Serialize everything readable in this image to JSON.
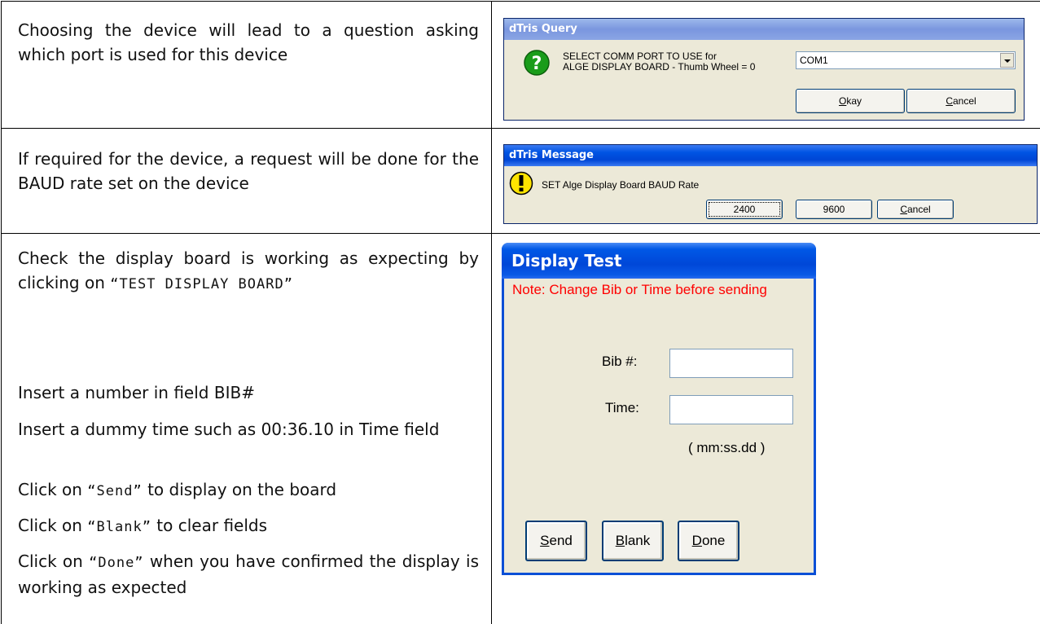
{
  "rows": [
    {
      "text": "Choosing the device will lead to a question asking which port is used for this device",
      "dialog": {
        "title": "dTris Query",
        "prompt_line1": "SELECT COMM PORT TO USE for",
        "prompt_line2": "ALGE DISPLAY BOARD - Thumb Wheel = 0",
        "combo_value": "COM1",
        "ok_label_mnemonic": "O",
        "ok_label_rest": "kay",
        "cancel_label_mnemonic": "C",
        "cancel_label_rest": "ancel",
        "icon": "question-icon"
      }
    },
    {
      "text": "If required for the device, a request will be done for the BAUD rate set on the device",
      "dialog": {
        "title": "dTris Message",
        "prompt": "SET Alge Display Board BAUD Rate",
        "btn1": "2400",
        "btn2": "9600",
        "cancel_label_mnemonic": "C",
        "cancel_label_rest": "ancel",
        "icon": "exclamation-icon"
      }
    },
    {
      "text_intro_1": "Check the display board is working as expecting by clicking on ",
      "text_intro_code": "“TEST DISPLAY BOARD”",
      "step1": "Insert a number in field BIB#",
      "step2": "Insert a dummy time such as 00:36.10 in Time field",
      "step3_pre": "Click on ",
      "step3_code": "“Send”",
      "step3_post": " to display on the board",
      "step4_pre": "Click on ",
      "step4_code": "“Blank”",
      "step4_post": " to clear fields",
      "step5_pre": "Click on ",
      "step5_code": "“Done”",
      "step5_post": " when you have confirmed the display is working as expected",
      "dialog": {
        "title": "Display Test",
        "note": "Note: Change Bib or Time before sending",
        "bib_label": "Bib #:",
        "time_label": "Time:",
        "time_hint": "( mm:ss.dd )",
        "bib_value": "",
        "time_value": "",
        "send_mnemonic": "S",
        "send_rest": "end",
        "blank_mnemonic": "B",
        "blank_rest": "lank",
        "done_mnemonic": "D",
        "done_rest": "one"
      }
    }
  ],
  "colors": {
    "note_red": "#ff0000",
    "xp_blue": "#0054e3",
    "dialog_face": "#ece9d8"
  }
}
